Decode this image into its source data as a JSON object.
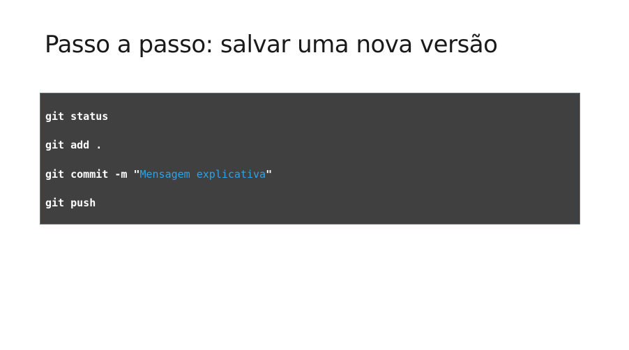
{
  "slide": {
    "title": "Passo a passo: salvar uma nova versão"
  },
  "code": {
    "line1": "git status",
    "line2": "git add .",
    "line3_cmd": "git commit -m ",
    "line3_quote_open": "\"",
    "line3_message": "Mensagem explicativa",
    "line3_quote_close": "\"",
    "line4": "git push"
  },
  "colors": {
    "code_background": "#404040",
    "code_text": "#ffffff",
    "string_highlight": "#2fa3e6",
    "code_border": "#3f7fa8"
  }
}
